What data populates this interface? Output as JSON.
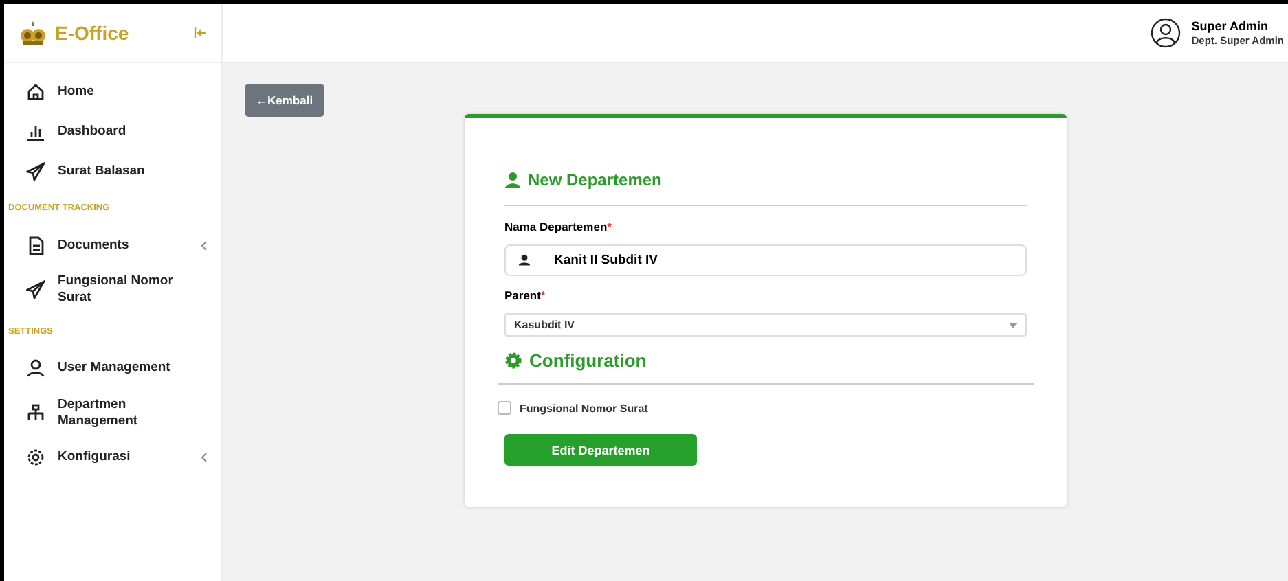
{
  "brand": {
    "name": "E-Office"
  },
  "sidebar": {
    "items": [
      {
        "kind": "item",
        "label": "Home",
        "has_submenu": false
      },
      {
        "kind": "item",
        "label": "Dashboard",
        "has_submenu": false
      },
      {
        "kind": "item",
        "label": "Surat Balasan",
        "has_submenu": false
      },
      {
        "kind": "section",
        "label": "DOCUMENT TRACKING"
      },
      {
        "kind": "item",
        "label": "Documents",
        "has_submenu": true
      },
      {
        "kind": "item",
        "label": "Fungsional Nomor Surat",
        "has_submenu": false
      },
      {
        "kind": "section",
        "label": "SETTINGS"
      },
      {
        "kind": "item",
        "label": "User Management",
        "has_submenu": false
      },
      {
        "kind": "item",
        "label": "Departmen Management",
        "has_submenu": false
      },
      {
        "kind": "item",
        "label": "Konfigurasi",
        "has_submenu": true
      }
    ]
  },
  "user": {
    "name": "Super Admin",
    "department": "Dept. Super Admin"
  },
  "back_button": "←Kembali",
  "form": {
    "title": "New Departemen",
    "name_field": {
      "label": "Nama Departemen",
      "required_mark": "*",
      "value": "Kanit II Subdit IV"
    },
    "parent_field": {
      "label": "Parent",
      "required_mark": "*",
      "value": "Kasubdit IV"
    },
    "config_title": "Configuration",
    "checkbox": {
      "label": "Fungsional Nomor Surat",
      "checked": false
    },
    "submit": "Edit Departemen"
  }
}
